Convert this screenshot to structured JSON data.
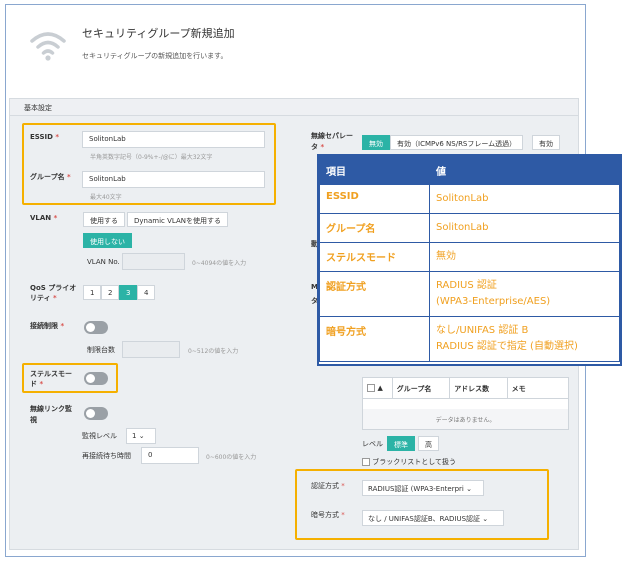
{
  "header": {
    "title": "セキュリティグループ新規追加",
    "subtitle": "セキュリティグループの新規追加を行います。"
  },
  "panel": {
    "title": "基本設定"
  },
  "essid": {
    "label": "ESSID",
    "required": "*",
    "value": "SolitonLab",
    "hint": "半角英数字記号（0-9%+-/@に）最大32文字"
  },
  "group_name": {
    "label": "グループ名",
    "required": "*",
    "value": "SolitonLab",
    "hint": "最大40文字"
  },
  "vlan": {
    "label": "VLAN",
    "required": "*",
    "btn_use": "使用する",
    "btn_dynamic": "Dynamic VLANを使用する",
    "btn_none": "使用しない",
    "no_label": "VLAN No.",
    "hint": "0~4094の値を入力"
  },
  "qos": {
    "label": "QoS プライオリティ",
    "required": "*",
    "options": [
      "1",
      "2",
      "3",
      "4"
    ],
    "selected": "3"
  },
  "connection_limit": {
    "label": "接続制限",
    "required": "*",
    "count_label": "制限台数",
    "hint": "0~512の値を入力"
  },
  "stealth": {
    "label": "ステルスモード",
    "required": "*"
  },
  "wireless_link": {
    "label": "無線リンク監視",
    "level_label": "監視レベル",
    "level_value": "1",
    "wait_label": "再接続待ち時間",
    "wait_value": "0",
    "wait_hint": "0~600の値を入力"
  },
  "separator": {
    "label": "無線セパレータ",
    "required": "*",
    "options": [
      "無効",
      "有効（ICMPv6 NS/RSフレーム透過）",
      "有効"
    ],
    "selected": "無効"
  },
  "side_labels": {
    "dynamic": "動",
    "mac": "Ma",
    "mac2": "タ"
  },
  "group_table": {
    "columns": [
      "▲",
      "グループ名",
      "アドレス数",
      "メモ"
    ],
    "empty": "データはありません。",
    "level_label": "レベル",
    "level_options": [
      "標準",
      "高"
    ],
    "level_selected": "標準",
    "blacklist": "ブラックリストとして扱う"
  },
  "auth": {
    "label": "認証方式",
    "required": "*",
    "value": "RADIUS認証 (WPA3-Enterpri"
  },
  "cipher": {
    "label": "暗号方式",
    "required": "*",
    "value": "なし / UNIFAS認証B、RADIUS認証"
  },
  "overlay": {
    "head_key": "項目",
    "head_val": "値",
    "rows": [
      {
        "k": "ESSID",
        "v1": "SolitonLab",
        "v2": ""
      },
      {
        "k": "グループ名",
        "v1": "SolitonLab",
        "v2": ""
      },
      {
        "k": "ステルスモード",
        "v1": "無効",
        "v2": ""
      },
      {
        "k": "認証方式",
        "v1": "RADIUS 認証",
        "v2": "(WPA3-Enterprise/AES)"
      },
      {
        "k": "暗号方式",
        "v1": "なし/UNIFAS 認証 B",
        "v2": "RADIUS 認証で指定 (自動選択)"
      }
    ]
  },
  "colors": {
    "accent": "#2bb3a6",
    "highlight": "#f5b000",
    "overlay_border": "#2e5aa5",
    "overlay_text": "#f0a020"
  }
}
